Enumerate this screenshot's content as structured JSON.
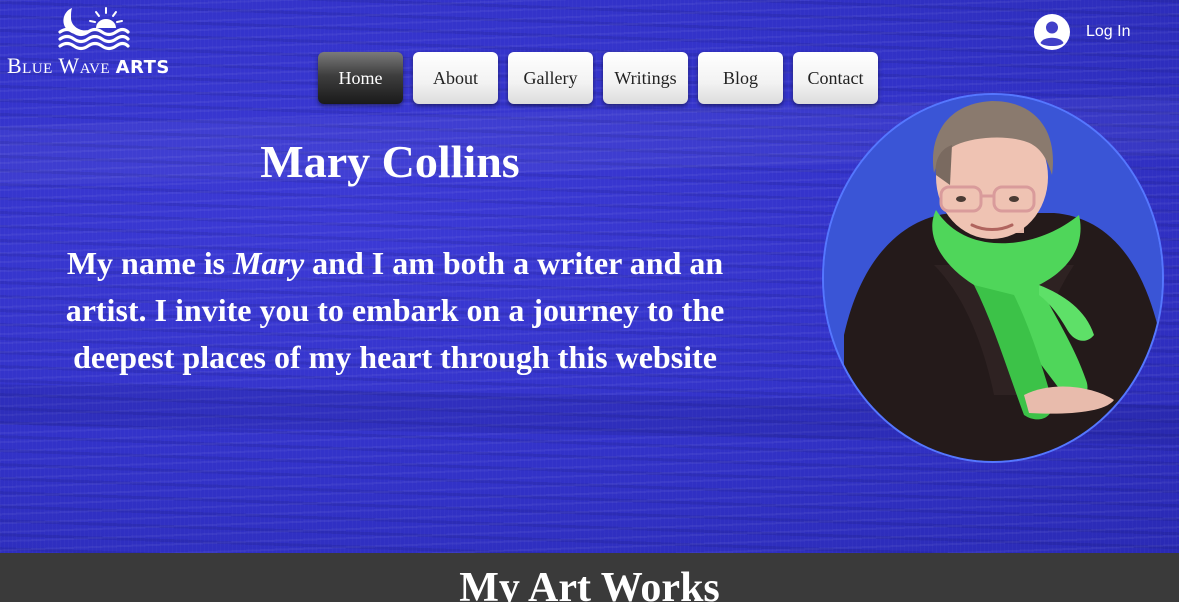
{
  "site": {
    "logo_text_first": "Blue Wave",
    "logo_text_second": "ARTS"
  },
  "header": {
    "login_label": "Log In"
  },
  "nav": {
    "items": [
      {
        "label": "Home",
        "active": true
      },
      {
        "label": "About",
        "active": false
      },
      {
        "label": "Gallery",
        "active": false
      },
      {
        "label": "Writings",
        "active": false
      },
      {
        "label": "Blog",
        "active": false
      },
      {
        "label": "Contact",
        "active": false
      }
    ]
  },
  "hero": {
    "title": "Mary Collins",
    "intro_prefix": "My name is ",
    "intro_name": "Mary",
    "intro_rest": " and I am both a writer and an artist. I invite you to embark  on a journey to the deepest places of my heart through this website"
  },
  "section": {
    "title": "My Art Works"
  },
  "colors": {
    "hero_background": "#3232c8",
    "portrait_ring": "#5577ff",
    "band_background": "#3a3a3a",
    "scarf": "#4fd65a",
    "active_nav": "#2b2b2b"
  }
}
